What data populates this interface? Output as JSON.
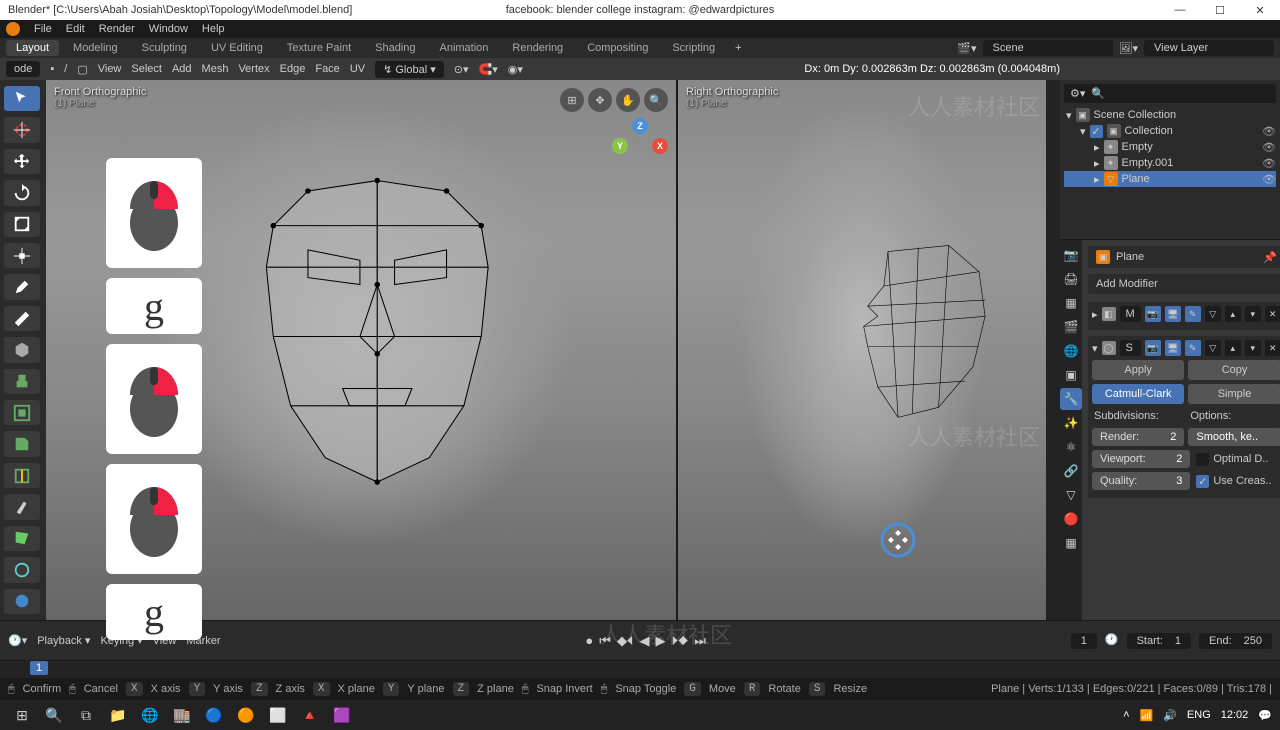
{
  "title": "Blender* [C:\\Users\\Abah Josiah\\Desktop\\Topology\\Model\\model.blend]",
  "social": "facebook: blender college   instagram: @edwardpictures",
  "menu": [
    "File",
    "Edit",
    "Render",
    "Window",
    "Help"
  ],
  "workspaces": [
    "Layout",
    "Modeling",
    "Sculpting",
    "UV Editing",
    "Texture Paint",
    "Shading",
    "Animation",
    "Rendering",
    "Compositing",
    "Scripting"
  ],
  "workspaces_plus": "+",
  "scene_name": "Scene",
  "view_layer": "View Layer",
  "header": {
    "mode": "ode",
    "view": "View",
    "select": "Select",
    "add": "Add",
    "mesh": "Mesh",
    "vertex": "Vertex",
    "edge": "Edge",
    "face": "Face",
    "uv": "UV",
    "orient": "Global"
  },
  "transform_readout": "Dx: 0m   Dy: 0.002863m   Dz: 0.002863m (0.004048m)",
  "viewports": {
    "left": {
      "name": "Front Orthographic",
      "sub": "(1) Plane"
    },
    "right": {
      "name": "Right Orthographic",
      "sub": "(1) Plane"
    }
  },
  "mouse_key": "g",
  "axis_gizmo": {
    "x": "X",
    "y": "Y",
    "z": "Z"
  },
  "outliner": {
    "scene": "Scene Collection",
    "collection": "Collection",
    "items": [
      "Empty",
      "Empty.001",
      "Plane"
    ]
  },
  "props": {
    "breadcrumb_obj": "Plane",
    "add_modifier": "Add Modifier",
    "mod1_name": "M",
    "mod2_name": "S",
    "apply": "Apply",
    "copy": "Copy",
    "catmull": "Catmull-Clark",
    "simple": "Simple",
    "subdiv_hdr": "Subdivisions:",
    "options_hdr": "Options:",
    "render": {
      "label": "Render:",
      "val": "2"
    },
    "viewport": {
      "label": "Viewport:",
      "val": "2"
    },
    "quality": {
      "label": "Quality:",
      "val": "3"
    },
    "smooth": "Smooth, ke..",
    "optimal": "Optimal D..",
    "use_creas": "Use Creas.."
  },
  "timeline": {
    "playback": "Playback",
    "keying": "Keying",
    "view": "View",
    "marker": "Marker",
    "current_frame": "1",
    "start_label": "Start:",
    "start_val": "1",
    "end_label": "End:",
    "end_val": "250",
    "ruler_frame": "1"
  },
  "status": {
    "confirm": "Confirm",
    "cancel": "Cancel",
    "xaxis": "X axis",
    "yaxis": "Y axis",
    "zaxis": "Z axis",
    "xplane": "X plane",
    "yplane": "Y plane",
    "zplane": "Z plane",
    "snapinv": "Snap Invert",
    "snaptog": "Snap Toggle",
    "move": "Move",
    "rotate": "Rotate",
    "resize": "Resize",
    "stats": "Plane | Verts:1/133 | Edges:0/221 | Faces:0/89 | Tris:178 |"
  },
  "taskbar": {
    "lang": "ENG",
    "time": "12:02"
  },
  "watermark": "人人素材社区"
}
